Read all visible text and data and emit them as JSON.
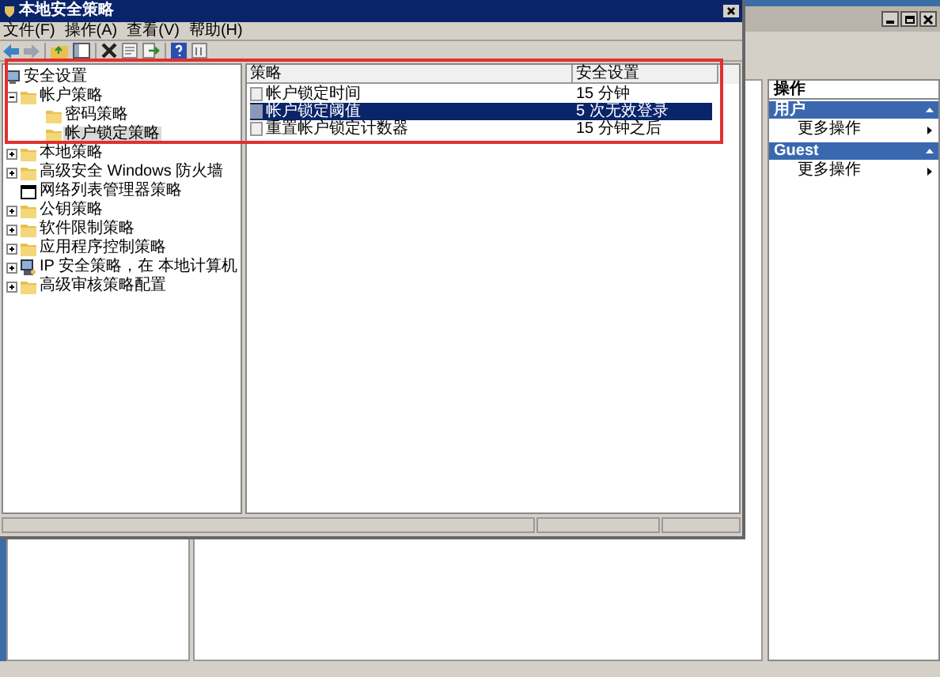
{
  "window": {
    "title": "本地安全策略"
  },
  "menu": [
    "文件(F)",
    "操作(A)",
    "查看(V)",
    "帮助(H)"
  ],
  "tree": [
    {
      "label": "安全设置",
      "kind": "computer",
      "selected": false,
      "children": [
        {
          "label": "帐户策略",
          "kind": "folder",
          "expandable": true,
          "expanded": true,
          "selected": false,
          "children": [
            {
              "label": "密码策略",
              "kind": "folder",
              "selected": false
            },
            {
              "label": "帐户锁定策略",
              "kind": "folder",
              "selected": true
            }
          ]
        },
        {
          "label": "本地策略",
          "kind": "folder",
          "expandable": true,
          "expanded": false,
          "selected": false
        },
        {
          "label": "高级安全 Windows 防火墙",
          "kind": "folder",
          "expandable": true,
          "expanded": false,
          "selected": false
        },
        {
          "label": "网络列表管理器策略",
          "kind": "window",
          "selected": false
        },
        {
          "label": "公钥策略",
          "kind": "folder",
          "expandable": true,
          "expanded": false,
          "selected": false
        },
        {
          "label": "软件限制策略",
          "kind": "folder",
          "expandable": true,
          "expanded": false,
          "selected": false
        },
        {
          "label": "应用程序控制策略",
          "kind": "folder",
          "expandable": true,
          "expanded": false,
          "selected": false
        },
        {
          "label": "IP 安全策略，在 本地计算机",
          "kind": "network",
          "expandable": true,
          "expanded": false,
          "selected": false
        },
        {
          "label": "高级审核策略配置",
          "kind": "folder",
          "expandable": true,
          "expanded": false,
          "selected": false
        }
      ]
    }
  ],
  "list": {
    "columns": [
      "策略",
      "安全设置"
    ],
    "rows": [
      {
        "policy": "帐户锁定时间",
        "setting": "15 分钟",
        "selected": false
      },
      {
        "policy": "帐户锁定阈值",
        "setting": "5 次无效登录",
        "selected": true
      },
      {
        "policy": "重置帐户锁定计数器",
        "setting": "15 分钟之后",
        "selected": false
      }
    ]
  },
  "actions": {
    "title": "操作",
    "sections": [
      {
        "title": "用户",
        "items": [
          "更多操作"
        ]
      },
      {
        "title": "Guest",
        "items": [
          "更多操作"
        ]
      }
    ]
  }
}
